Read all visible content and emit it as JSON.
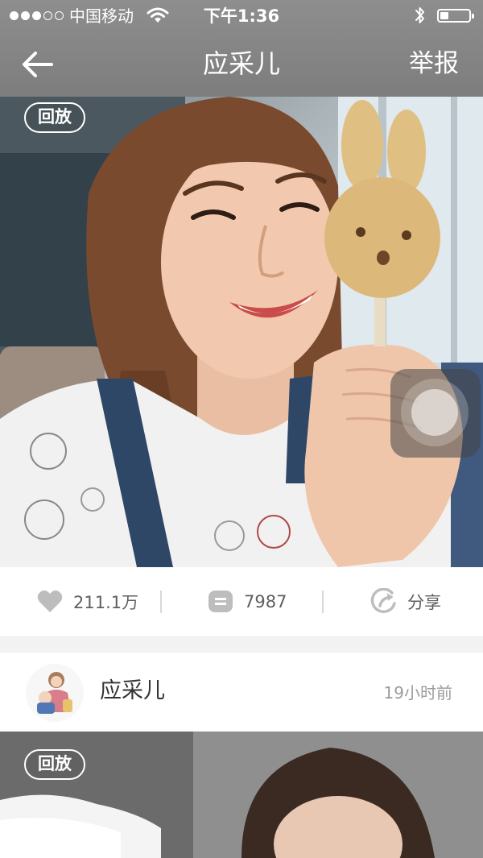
{
  "status_bar": {
    "carrier": "中国移动",
    "time": "下午1:36",
    "signal_bars_filled": 3,
    "signal_bars_total": 5,
    "battery_level": 0.3,
    "wifi_icon": "wifi-icon",
    "bluetooth_icon": "bluetooth-icon"
  },
  "nav": {
    "back_icon": "arrow-left-icon",
    "title": "应采儿",
    "report_label": "举报"
  },
  "post1": {
    "replay_badge": "回放",
    "floating_button_icon": "assistive-touch-icon"
  },
  "stats": {
    "likes": "211.1万",
    "like_icon": "heart-icon",
    "comments": "7987",
    "comment_icon": "comment-bubble-icon",
    "share_label": "分享",
    "share_icon": "share-arrow-icon"
  },
  "author": {
    "name": "应采儿",
    "time_ago": "19小时前"
  },
  "post2": {
    "replay_badge": "回放"
  },
  "colors": {
    "header_overlay": "#858585",
    "stat_text": "#5f5f5f",
    "icon_gray": "#bdbdbd",
    "time_gray": "#9b9b9b",
    "divider_band": "#f2f2f2"
  }
}
